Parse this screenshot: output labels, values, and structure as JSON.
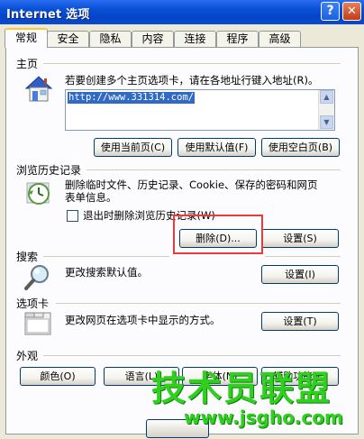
{
  "window": {
    "title": "Internet 选项",
    "help_glyph": "?",
    "close_glyph": "✕"
  },
  "tabs": [
    {
      "label": "常规",
      "active": true
    },
    {
      "label": "安全"
    },
    {
      "label": "隐私"
    },
    {
      "label": "内容"
    },
    {
      "label": "连接"
    },
    {
      "label": "程序"
    },
    {
      "label": "高级"
    }
  ],
  "homepage": {
    "title": "主页",
    "description": "若要创建多个主页选项卡，请在各地址行键入地址(R)。",
    "url": "http://www.331314.com/",
    "buttons": {
      "use_current": "使用当前页(C)",
      "use_default": "使用默认值(F)",
      "use_blank": "使用空白页(B)"
    }
  },
  "history": {
    "title": "浏览历史记录",
    "description_line1": "删除临时文件、历史记录、Cookie、保存的密码和网页",
    "description_line2": "表单信息。",
    "checkbox_label": "退出时删除浏览历史记录(W)",
    "buttons": {
      "delete": "删除(D)...",
      "settings": "设置(S)"
    }
  },
  "search": {
    "title": "搜索",
    "description": "更改搜索默认值。",
    "settings_button": "设置(I)"
  },
  "tabs_section": {
    "title": "选项卡",
    "description": "更改网页在选项卡中显示的方式。",
    "settings_button": "设置(T)"
  },
  "appearance": {
    "title": "外观",
    "buttons": {
      "colors": "颜色(O)",
      "languages": "语言(L)",
      "fonts": "字体(N)",
      "accessibility": "辅助功能(E)"
    }
  },
  "watermark": {
    "main": "技术员联盟",
    "url": "www.jsgho.com"
  },
  "colors": {
    "titlebar": "#0a52d8",
    "panel_bg": "#fcfcfe",
    "window_bg": "#ece9d8",
    "highlight_box": "#e83c3c",
    "watermark": "#2fd11e"
  }
}
